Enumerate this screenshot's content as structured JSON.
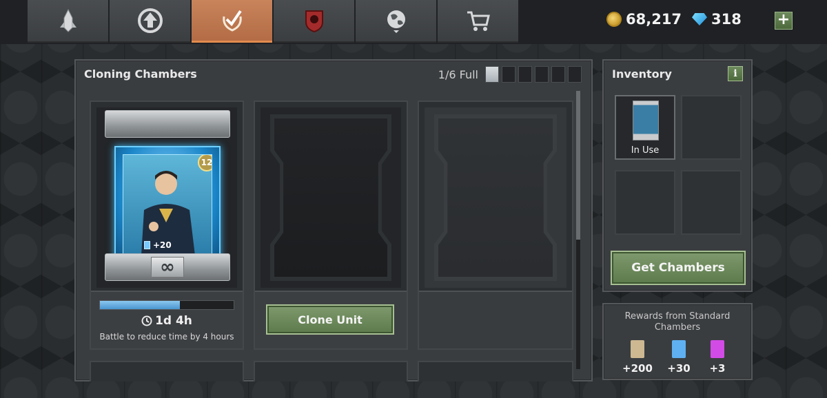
{
  "nav": {
    "tabs": [
      {
        "name": "units",
        "icon": "rocket-tab-icon"
      },
      {
        "name": "upgrade",
        "icon": "upgrade-arrow-icon"
      },
      {
        "name": "cloning",
        "icon": "laurel-check-icon",
        "active": true
      },
      {
        "name": "faction",
        "icon": "demon-shield-icon"
      },
      {
        "name": "world",
        "icon": "globe-icon"
      },
      {
        "name": "store",
        "icon": "shopping-cart-icon"
      }
    ],
    "coins": "68,217",
    "gems": "318",
    "add_label": "+"
  },
  "cloning": {
    "title": "Cloning Chambers",
    "capacity_label": "1/6 Full",
    "capacity_used": 1,
    "capacity_total": 6,
    "active_chamber": {
      "level": "12",
      "bonus": "+20",
      "progress": 0.6,
      "timer": "1d 4h",
      "hint": "Battle to reduce time by 4 hours",
      "plate_symbol": "∞"
    },
    "clone_button": "Clone Unit"
  },
  "inventory": {
    "title": "Inventory",
    "info_label": "i",
    "slots": [
      {
        "status": "In Use"
      },
      {
        "status": ""
      },
      {
        "status": ""
      },
      {
        "status": ""
      }
    ],
    "get_chambers_button": "Get Chambers"
  },
  "rewards": {
    "title": "Rewards from Standard Chambers",
    "items": [
      {
        "value": "+200",
        "color": "#cdb892"
      },
      {
        "value": "+30",
        "color": "#5fb0f2"
      },
      {
        "value": "+3",
        "color": "#d24be6"
      }
    ]
  }
}
